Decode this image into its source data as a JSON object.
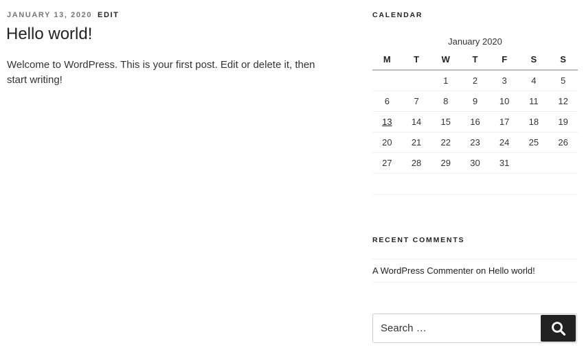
{
  "post": {
    "date": "January 13, 2020",
    "edit": "Edit",
    "title": "Hello world!",
    "content": "Welcome to WordPress. This is your first post. Edit or delete it, then start writing!"
  },
  "calendar": {
    "title": "Calendar",
    "caption": "January 2020",
    "weekdays": [
      "M",
      "T",
      "W",
      "T",
      "F",
      "S",
      "S"
    ],
    "weeks": [
      [
        "",
        "",
        "1",
        "2",
        "3",
        "4",
        "5"
      ],
      [
        "6",
        "7",
        "8",
        "9",
        "10",
        "11",
        "12"
      ],
      [
        "13",
        "14",
        "15",
        "16",
        "17",
        "18",
        "19"
      ],
      [
        "20",
        "21",
        "22",
        "23",
        "24",
        "25",
        "26"
      ],
      [
        "27",
        "28",
        "29",
        "30",
        "31",
        "",
        ""
      ]
    ],
    "linked_day": "13"
  },
  "recent_comments": {
    "title": "Recent Comments",
    "items": [
      {
        "author": "A WordPress Commenter",
        "connector": "on",
        "post": "Hello world!"
      }
    ]
  },
  "search": {
    "placeholder": "Search …",
    "button_icon": "search-icon"
  }
}
